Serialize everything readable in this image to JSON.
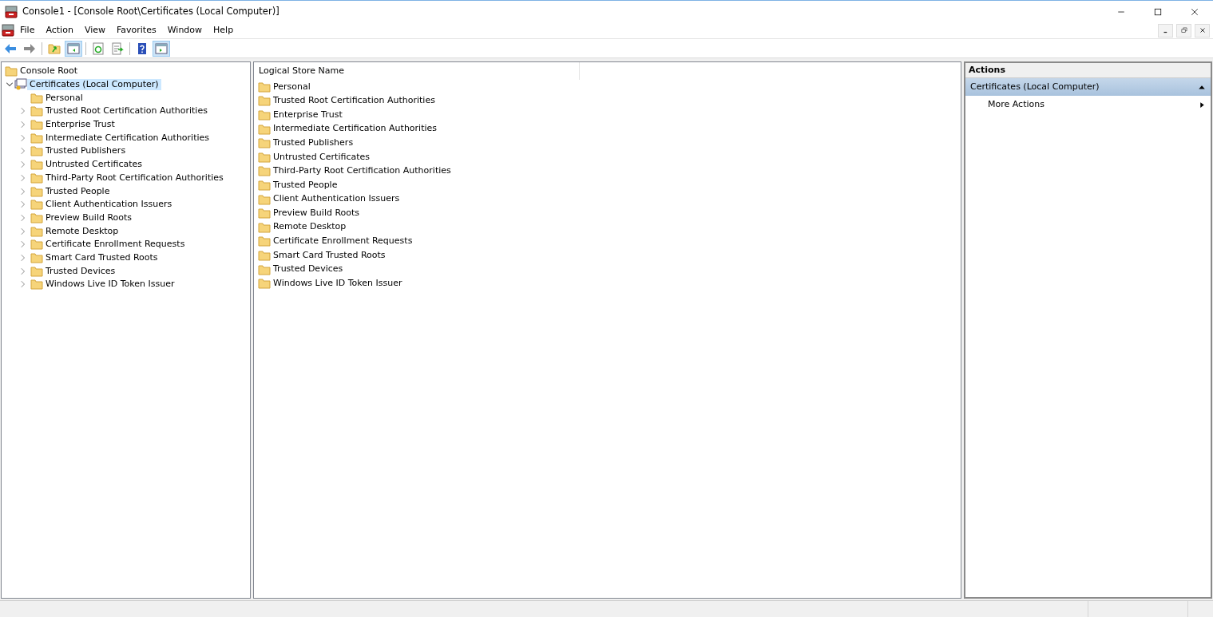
{
  "window": {
    "title": "Console1 - [Console Root\\Certificates (Local Computer)]"
  },
  "menu": [
    "File",
    "Action",
    "View",
    "Favorites",
    "Window",
    "Help"
  ],
  "toolbar": [
    {
      "kind": "back",
      "disabled": false,
      "pressed": false
    },
    {
      "kind": "forward",
      "disabled": true,
      "pressed": false
    },
    {
      "kind": "sep"
    },
    {
      "kind": "up",
      "pressed": false
    },
    {
      "kind": "tree",
      "pressed": true
    },
    {
      "kind": "sep"
    },
    {
      "kind": "refresh",
      "pressed": false
    },
    {
      "kind": "export",
      "pressed": false
    },
    {
      "kind": "sep"
    },
    {
      "kind": "help",
      "pressed": false
    },
    {
      "kind": "actionpane",
      "pressed": true
    }
  ],
  "tree": {
    "label": "Console Root",
    "children": [
      {
        "label": "Certificates (Local Computer)",
        "expanded": true,
        "selected": true,
        "children": [
          {
            "label": "Personal",
            "expandable": false
          },
          {
            "label": "Trusted Root Certification Authorities",
            "expandable": true
          },
          {
            "label": "Enterprise Trust",
            "expandable": true
          },
          {
            "label": "Intermediate Certification Authorities",
            "expandable": true
          },
          {
            "label": "Trusted Publishers",
            "expandable": true
          },
          {
            "label": "Untrusted Certificates",
            "expandable": true
          },
          {
            "label": "Third-Party Root Certification Authorities",
            "expandable": true
          },
          {
            "label": "Trusted People",
            "expandable": true
          },
          {
            "label": "Client Authentication Issuers",
            "expandable": true
          },
          {
            "label": "Preview Build Roots",
            "expandable": true
          },
          {
            "label": "Remote Desktop",
            "expandable": true
          },
          {
            "label": "Certificate Enrollment Requests",
            "expandable": true
          },
          {
            "label": "Smart Card Trusted Roots",
            "expandable": true
          },
          {
            "label": "Trusted Devices",
            "expandable": true
          },
          {
            "label": "Windows Live ID Token Issuer",
            "expandable": true
          }
        ]
      }
    ]
  },
  "list": {
    "columns": [
      "Logical Store Name"
    ],
    "rows": [
      "Personal",
      "Trusted Root Certification Authorities",
      "Enterprise Trust",
      "Intermediate Certification Authorities",
      "Trusted Publishers",
      "Untrusted Certificates",
      "Third-Party Root Certification Authorities",
      "Trusted People",
      "Client Authentication Issuers",
      "Preview Build Roots",
      "Remote Desktop",
      "Certificate Enrollment Requests",
      "Smart Card Trusted Roots",
      "Trusted Devices",
      "Windows Live ID Token Issuer"
    ]
  },
  "actions": {
    "title": "Actions",
    "section": "Certificates (Local Computer)",
    "items": [
      "More Actions"
    ]
  }
}
